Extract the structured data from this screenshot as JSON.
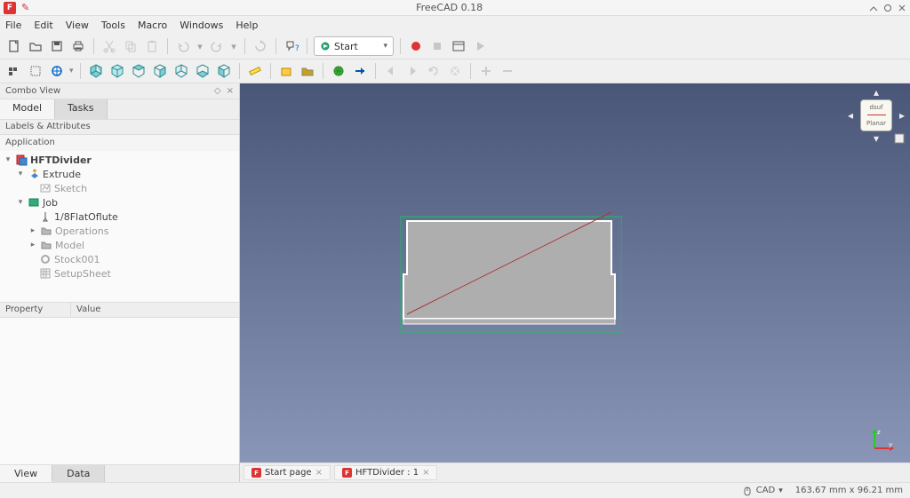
{
  "title": "FreeCAD 0.18",
  "menubar": [
    "File",
    "Edit",
    "View",
    "Tools",
    "Macro",
    "Windows",
    "Help"
  ],
  "workbench": {
    "label": "Start"
  },
  "combo": {
    "title": "Combo View",
    "tabs": {
      "model": "Model",
      "tasks": "Tasks"
    },
    "section1": "Labels & Attributes",
    "section2": "Application",
    "tree": {
      "root": "HFTDivider",
      "extrude": "Extrude",
      "sketch": "Sketch",
      "job": "Job",
      "tool": "1/8FlatOflute",
      "operations": "Operations",
      "model": "Model",
      "stock": "Stock001",
      "setup": "SetupSheet"
    },
    "prop_cols": {
      "property": "Property",
      "value": "Value"
    },
    "bottom_tabs": {
      "view": "View",
      "data": "Data"
    }
  },
  "doc_tabs": {
    "start": "Start page",
    "doc": "HFTDivider : 1"
  },
  "navcube": {
    "top": "dsuf",
    "bottom": "Planar"
  },
  "status": {
    "mode": "CAD",
    "dims": "163.67 mm x 96.21 mm"
  }
}
